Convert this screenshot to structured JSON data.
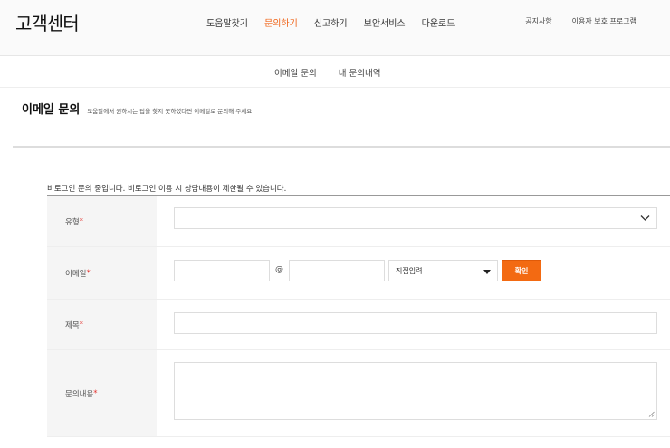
{
  "header": {
    "brand": "고객센터",
    "nav": [
      {
        "label": "도움말찾기",
        "active": false
      },
      {
        "label": "문의하기",
        "active": true
      },
      {
        "label": "신고하기",
        "active": false
      },
      {
        "label": "보안서비스",
        "active": false
      },
      {
        "label": "다운로드",
        "active": false
      }
    ],
    "util": [
      "공지사항",
      "이용자 보호 프로그램"
    ]
  },
  "subnav": [
    "이메일 문의",
    "내 문의내역"
  ],
  "page": {
    "title": "이메일 문의",
    "desc": "도움말에서 원하시는 답을 찾지 못하셨다면 이메일로 문의해 주세요"
  },
  "notice": "비로그인 문의 중입니다. 비로그인 이용 시 상담내용이 제한될 수 있습니다.",
  "form": {
    "type_label": "유형",
    "type_value": "",
    "email_label": "이메일",
    "email_id_value": "",
    "email_at": "@",
    "email_domain_value": "",
    "domain_select_value": "직접입력",
    "confirm_label": "확인",
    "subject_label": "제목",
    "subject_value": "",
    "content_label": "문의내용",
    "content_value": "",
    "required_mark": "*"
  },
  "colors": {
    "accent": "#f36a12",
    "active_nav": "#f06418",
    "required": "#e3322e"
  },
  "icons": {
    "type_select": "chevron-down-icon",
    "domain_select": "caret-down-icon",
    "textarea": "resize-grip-icon"
  }
}
